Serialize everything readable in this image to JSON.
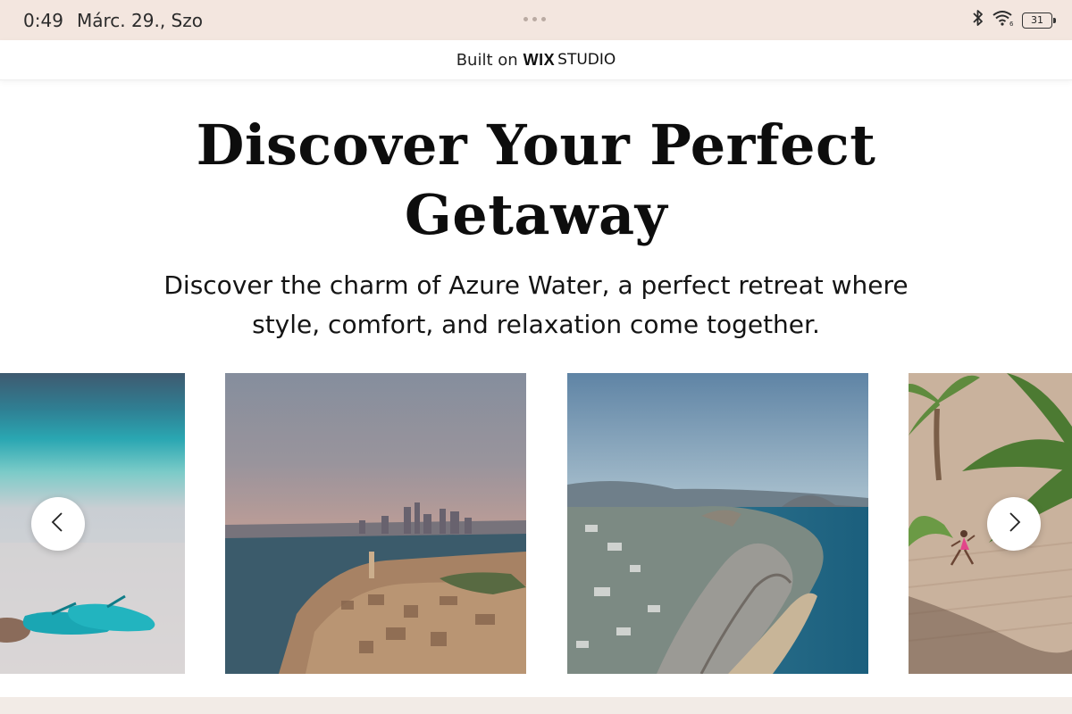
{
  "status_bar": {
    "time": "0:49",
    "date": "Márc. 29., Szo",
    "battery": "31",
    "icons": [
      "bluetooth-icon",
      "wifi-icon",
      "battery-icon"
    ],
    "background": "#f3e6df"
  },
  "wix_banner": {
    "built_on": "Built on",
    "logo_wix": "WIX",
    "logo_studio": "STUDIO"
  },
  "hero": {
    "title": "Discover Your Perfect Getaway",
    "subtitle": "Discover the charm of Azure Water, a perfect retreat where style, comfort, and relaxation come together."
  },
  "gallery": {
    "images": [
      "beach-sandals-photo",
      "coastal-old-city-photo",
      "cliff-coastline-photo",
      "palm-beach-runner-photo"
    ],
    "prev_icon": "chevron-left-icon",
    "next_icon": "chevron-right-icon"
  },
  "colors": {
    "footer_strip": "#f2ebe6",
    "text": "#0d0d0d"
  }
}
